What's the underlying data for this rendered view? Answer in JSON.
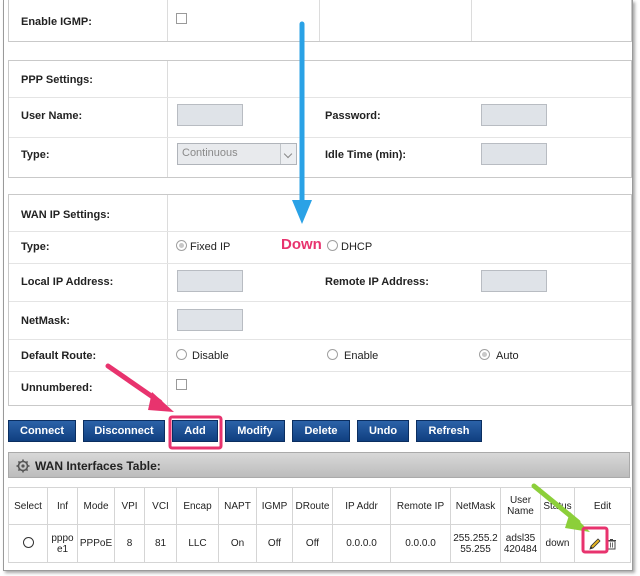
{
  "igmp": {
    "label": "Enable IGMP:"
  },
  "ppp": {
    "title": "PPP Settings:",
    "user_name_label": "User Name:",
    "password_label": "Password:",
    "type_label": "Type:",
    "type_value": "Continuous",
    "idle_label": "Idle Time (min):"
  },
  "wan": {
    "title": "WAN IP Settings:",
    "type_label": "Type:",
    "fixed_ip": "Fixed IP",
    "dhcp": "DHCP",
    "local_ip_label": "Local IP Address:",
    "remote_ip_label": "Remote IP Address:",
    "netmask_label": "NetMask:",
    "default_route_label": "Default Route:",
    "disable": "Disable",
    "enable": "Enable",
    "auto": "Auto",
    "unnumbered_label": "Unnumbered:"
  },
  "buttons": {
    "connect": "Connect",
    "disconnect": "Disconnect",
    "add": "Add",
    "modify": "Modify",
    "delete": "Delete",
    "undo": "Undo",
    "refresh": "Refresh"
  },
  "table": {
    "title": "WAN Interfaces Table:",
    "columns": [
      "Select",
      "Inf",
      "Mode",
      "VPI",
      "VCI",
      "Encap",
      "NAPT",
      "IGMP",
      "DRoute",
      "IP Addr",
      "Remote IP",
      "NetMask",
      "User Name",
      "Status",
      "Edit"
    ],
    "row": {
      "inf": "pppoe1",
      "mode": "PPPoE",
      "vpi": "8",
      "vci": "81",
      "encap": "LLC",
      "napt": "On",
      "igmp": "Off",
      "droute": "Off",
      "ip_addr": "0.0.0.0",
      "remote_ip": "0.0.0.0",
      "netmask": "255.255.255.255",
      "user_name": "adsl35420484",
      "status": "down"
    }
  },
  "annotation": {
    "down_label": "Down"
  },
  "colors": {
    "button": "#1a4f96",
    "annotation_pink": "#e8336e",
    "annotation_blue": "#2aa2e6",
    "annotation_green": "#8ccf3a"
  }
}
